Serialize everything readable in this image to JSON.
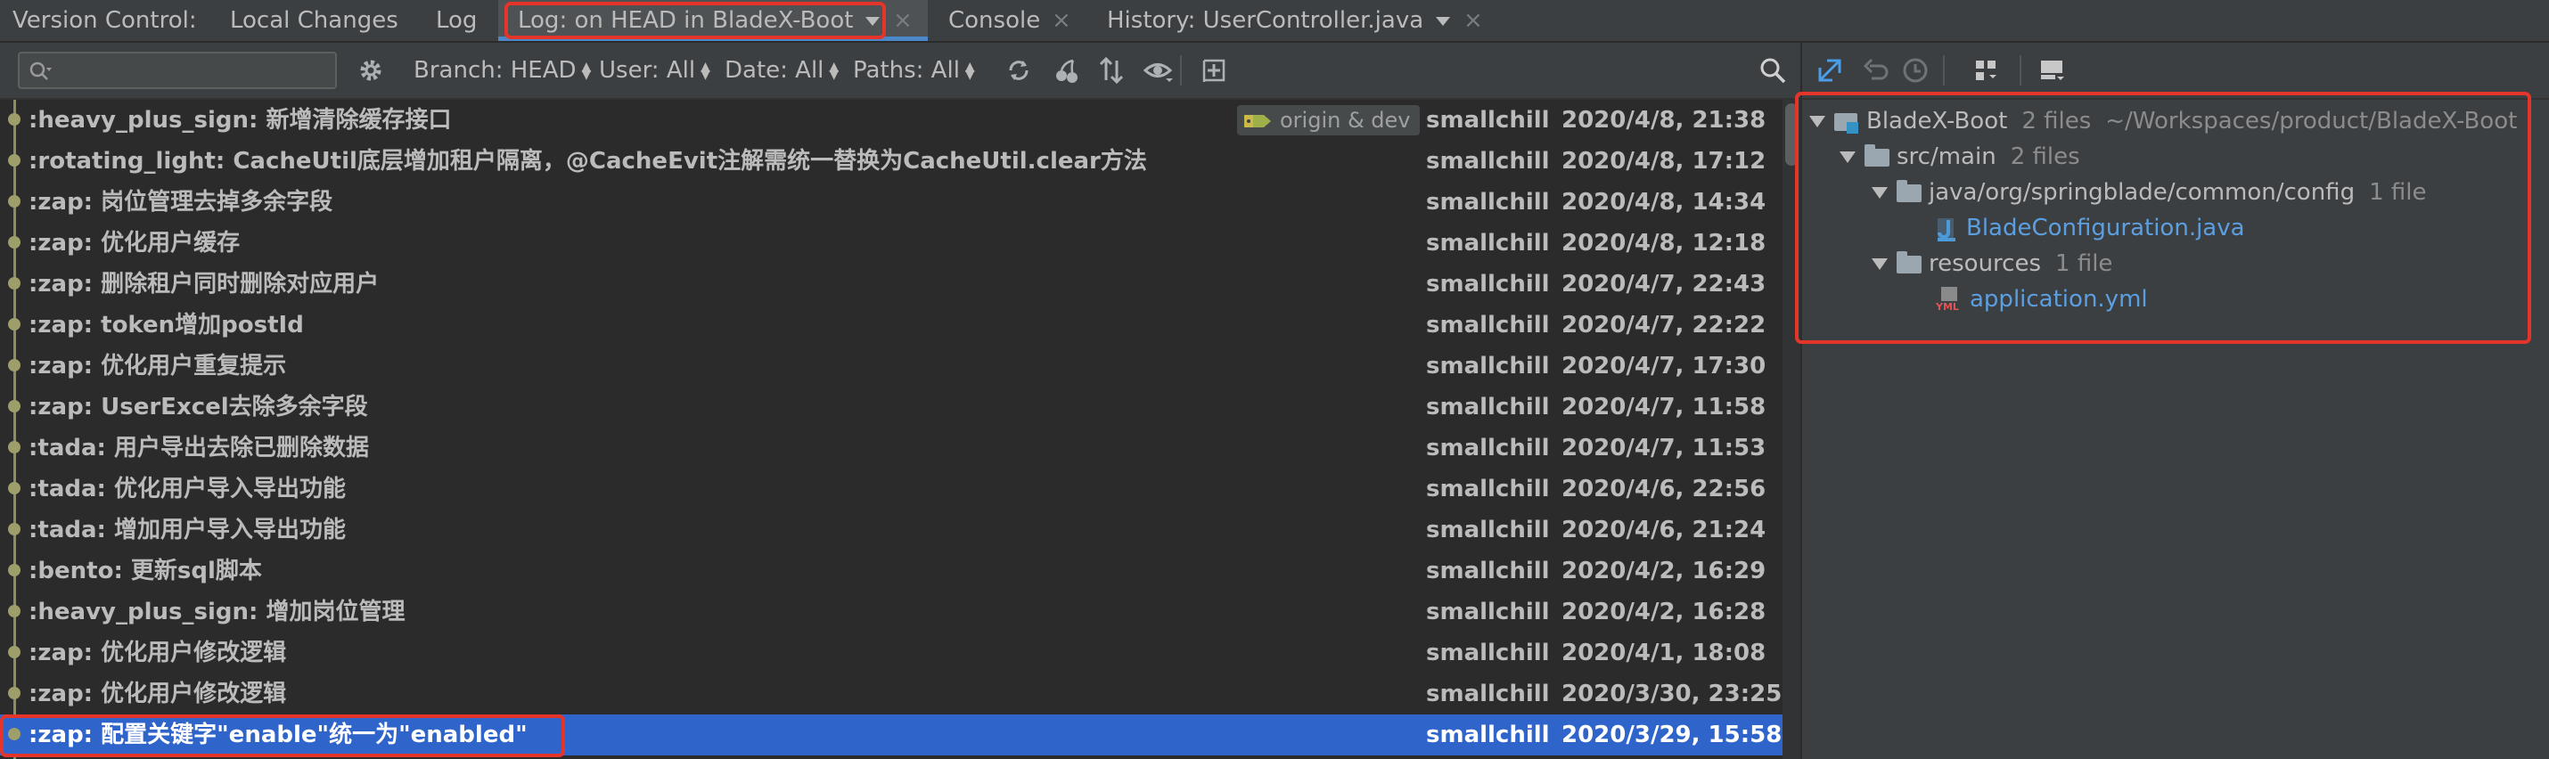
{
  "tabbar": {
    "prefix": "Version Control:",
    "tabs": [
      {
        "label": "Local Changes",
        "active": false,
        "closable": false
      },
      {
        "label": "Log",
        "active": false,
        "closable": false
      },
      {
        "label": "Log: on HEAD in BladeX-Boot",
        "active": true,
        "closable": true
      },
      {
        "label": "Console",
        "active": false,
        "closable": true
      },
      {
        "label": "History: UserController.java",
        "active": false,
        "closable": true
      }
    ],
    "close_glyph": "×"
  },
  "log_toolbar": {
    "search_placeholder": "",
    "filters": {
      "branch": "Branch: HEAD",
      "user": "User: All",
      "date": "Date: All",
      "paths": "Paths: All"
    },
    "icons": [
      "gear-icon",
      "refresh-icon",
      "cherry-pick-icon",
      "sort-icon",
      "eye-icon",
      "new-branch-icon",
      "search-icon"
    ]
  },
  "commits": [
    {
      "message": ":heavy_plus_sign: 新增清除缓存接口",
      "author": "smallchill",
      "date": "2020/4/8, 21:38",
      "branch_label": "origin & dev"
    },
    {
      "message": ":rotating_light: CacheUtil底层增加租户隔离，@CacheEvit注解需统一替换为CacheUtil.clear方法",
      "author": "smallchill",
      "date": "2020/4/8, 17:12"
    },
    {
      "message": ":zap: 岗位管理去掉多余字段",
      "author": "smallchill",
      "date": "2020/4/8, 14:34"
    },
    {
      "message": ":zap: 优化用户缓存",
      "author": "smallchill",
      "date": "2020/4/8, 12:18"
    },
    {
      "message": ":zap: 删除租户同时删除对应用户",
      "author": "smallchill",
      "date": "2020/4/7, 22:43"
    },
    {
      "message": ":zap: token增加postId",
      "author": "smallchill",
      "date": "2020/4/7, 22:22"
    },
    {
      "message": ":zap: 优化用户重复提示",
      "author": "smallchill",
      "date": "2020/4/7, 17:30"
    },
    {
      "message": ":zap: UserExcel去除多余字段",
      "author": "smallchill",
      "date": "2020/4/7, 11:58"
    },
    {
      "message": ":tada: 用户导出去除已删除数据",
      "author": "smallchill",
      "date": "2020/4/7, 11:53"
    },
    {
      "message": ":tada: 优化用户导入导出功能",
      "author": "smallchill",
      "date": "2020/4/6, 22:56"
    },
    {
      "message": ":tada: 增加用户导入导出功能",
      "author": "smallchill",
      "date": "2020/4/6, 21:24"
    },
    {
      "message": ":bento: 更新sql脚本",
      "author": "smallchill",
      "date": "2020/4/2, 16:29"
    },
    {
      "message": ":heavy_plus_sign: 增加岗位管理",
      "author": "smallchill",
      "date": "2020/4/2, 16:28"
    },
    {
      "message": ":zap: 优化用户修改逻辑",
      "author": "smallchill",
      "date": "2020/4/1, 18:08"
    },
    {
      "message": ":zap: 优化用户修改逻辑",
      "author": "smallchill",
      "date": "2020/3/30, 23:25"
    },
    {
      "message": ":zap: 配置关键字\"enable\"统一为\"enabled\"",
      "author": "smallchill",
      "date": "2020/3/29, 15:58",
      "selected": true
    }
  ],
  "right_panel": {
    "icons": [
      "expand-all-icon",
      "revert-icon",
      "history-icon",
      "group-by-icon",
      "preview-icon"
    ],
    "tree": {
      "root": {
        "name": "BladeX-Boot",
        "count": "2 files",
        "path": "~/Workspaces/product/BladeX-Boot"
      },
      "src_main": {
        "name": "src/main",
        "count": "2 files"
      },
      "config_dir": {
        "name": "java/org/springblade/common/config",
        "count": "1 file"
      },
      "java_file": {
        "name": "BladeConfiguration.java"
      },
      "resources_dir": {
        "name": "resources",
        "count": "1 file"
      },
      "yml_file": {
        "name": "application.yml",
        "icon_text": "YML"
      }
    }
  },
  "colors": {
    "accent": "#2f65ca",
    "highlight_box": "#e5352a",
    "file_link": "#5c9fe0"
  }
}
